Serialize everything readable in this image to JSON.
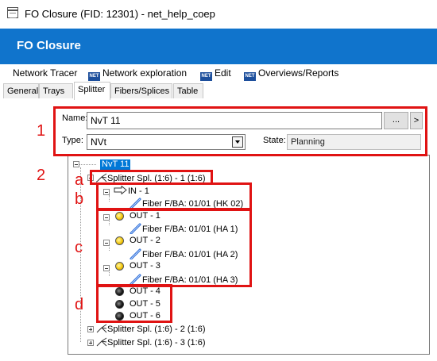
{
  "window": {
    "title": "FO Closure (FID: 12301) - net_help_coep"
  },
  "banner": {
    "title": "FO Closure"
  },
  "menu": [
    {
      "label": "Network Tracer",
      "icon": ""
    },
    {
      "label": "Network exploration",
      "icon": "net-icon"
    },
    {
      "label": "Edit",
      "icon": "net-icon"
    },
    {
      "label": "Overviews/Reports",
      "icon": "net-icon"
    }
  ],
  "net_icon_text": "NET",
  "tabs": [
    {
      "label": "General"
    },
    {
      "label": "Trays"
    },
    {
      "label": "Splitter",
      "active": true
    },
    {
      "label": "Fibers/Splices"
    },
    {
      "label": "Table"
    }
  ],
  "form": {
    "name_label": "Name:",
    "name_value": "NvT 11",
    "dots_label": "...",
    "arrow_label": ">",
    "type_label": "Type:",
    "type_value": "NVt",
    "state_label": "State:",
    "state_value": "Planning"
  },
  "tree": {
    "root": "NvT 11",
    "splitters": [
      "Splitter Spl. (1:6) - 1 (1:6)",
      "Splitter Spl. (1:6) - 2 (1:6)",
      "Splitter Spl. (1:6) - 3 (1:6)"
    ],
    "in_port": {
      "label": "IN - 1",
      "fiber": "Fiber F/BA: 01/01 (HK 02)"
    },
    "out_ports_connected": [
      {
        "label": "OUT - 1",
        "fiber": "Fiber F/BA: 01/01 (HA 1)"
      },
      {
        "label": "OUT - 2",
        "fiber": "Fiber F/BA: 01/01 (HA 2)"
      },
      {
        "label": "OUT - 3",
        "fiber": "Fiber F/BA: 01/01 (HA 3)"
      }
    ],
    "out_ports_free": [
      "OUT - 4",
      "OUT - 5",
      "OUT - 6"
    ]
  },
  "annotations": {
    "1": "1",
    "2": "2",
    "a": "a",
    "b": "b",
    "c": "c",
    "d": "d"
  },
  "colors": {
    "banner": "#1074cc",
    "annotation": "#e01313",
    "selection": "#0078d7",
    "port_connected": "#f2c200",
    "port_free": "#111111"
  }
}
